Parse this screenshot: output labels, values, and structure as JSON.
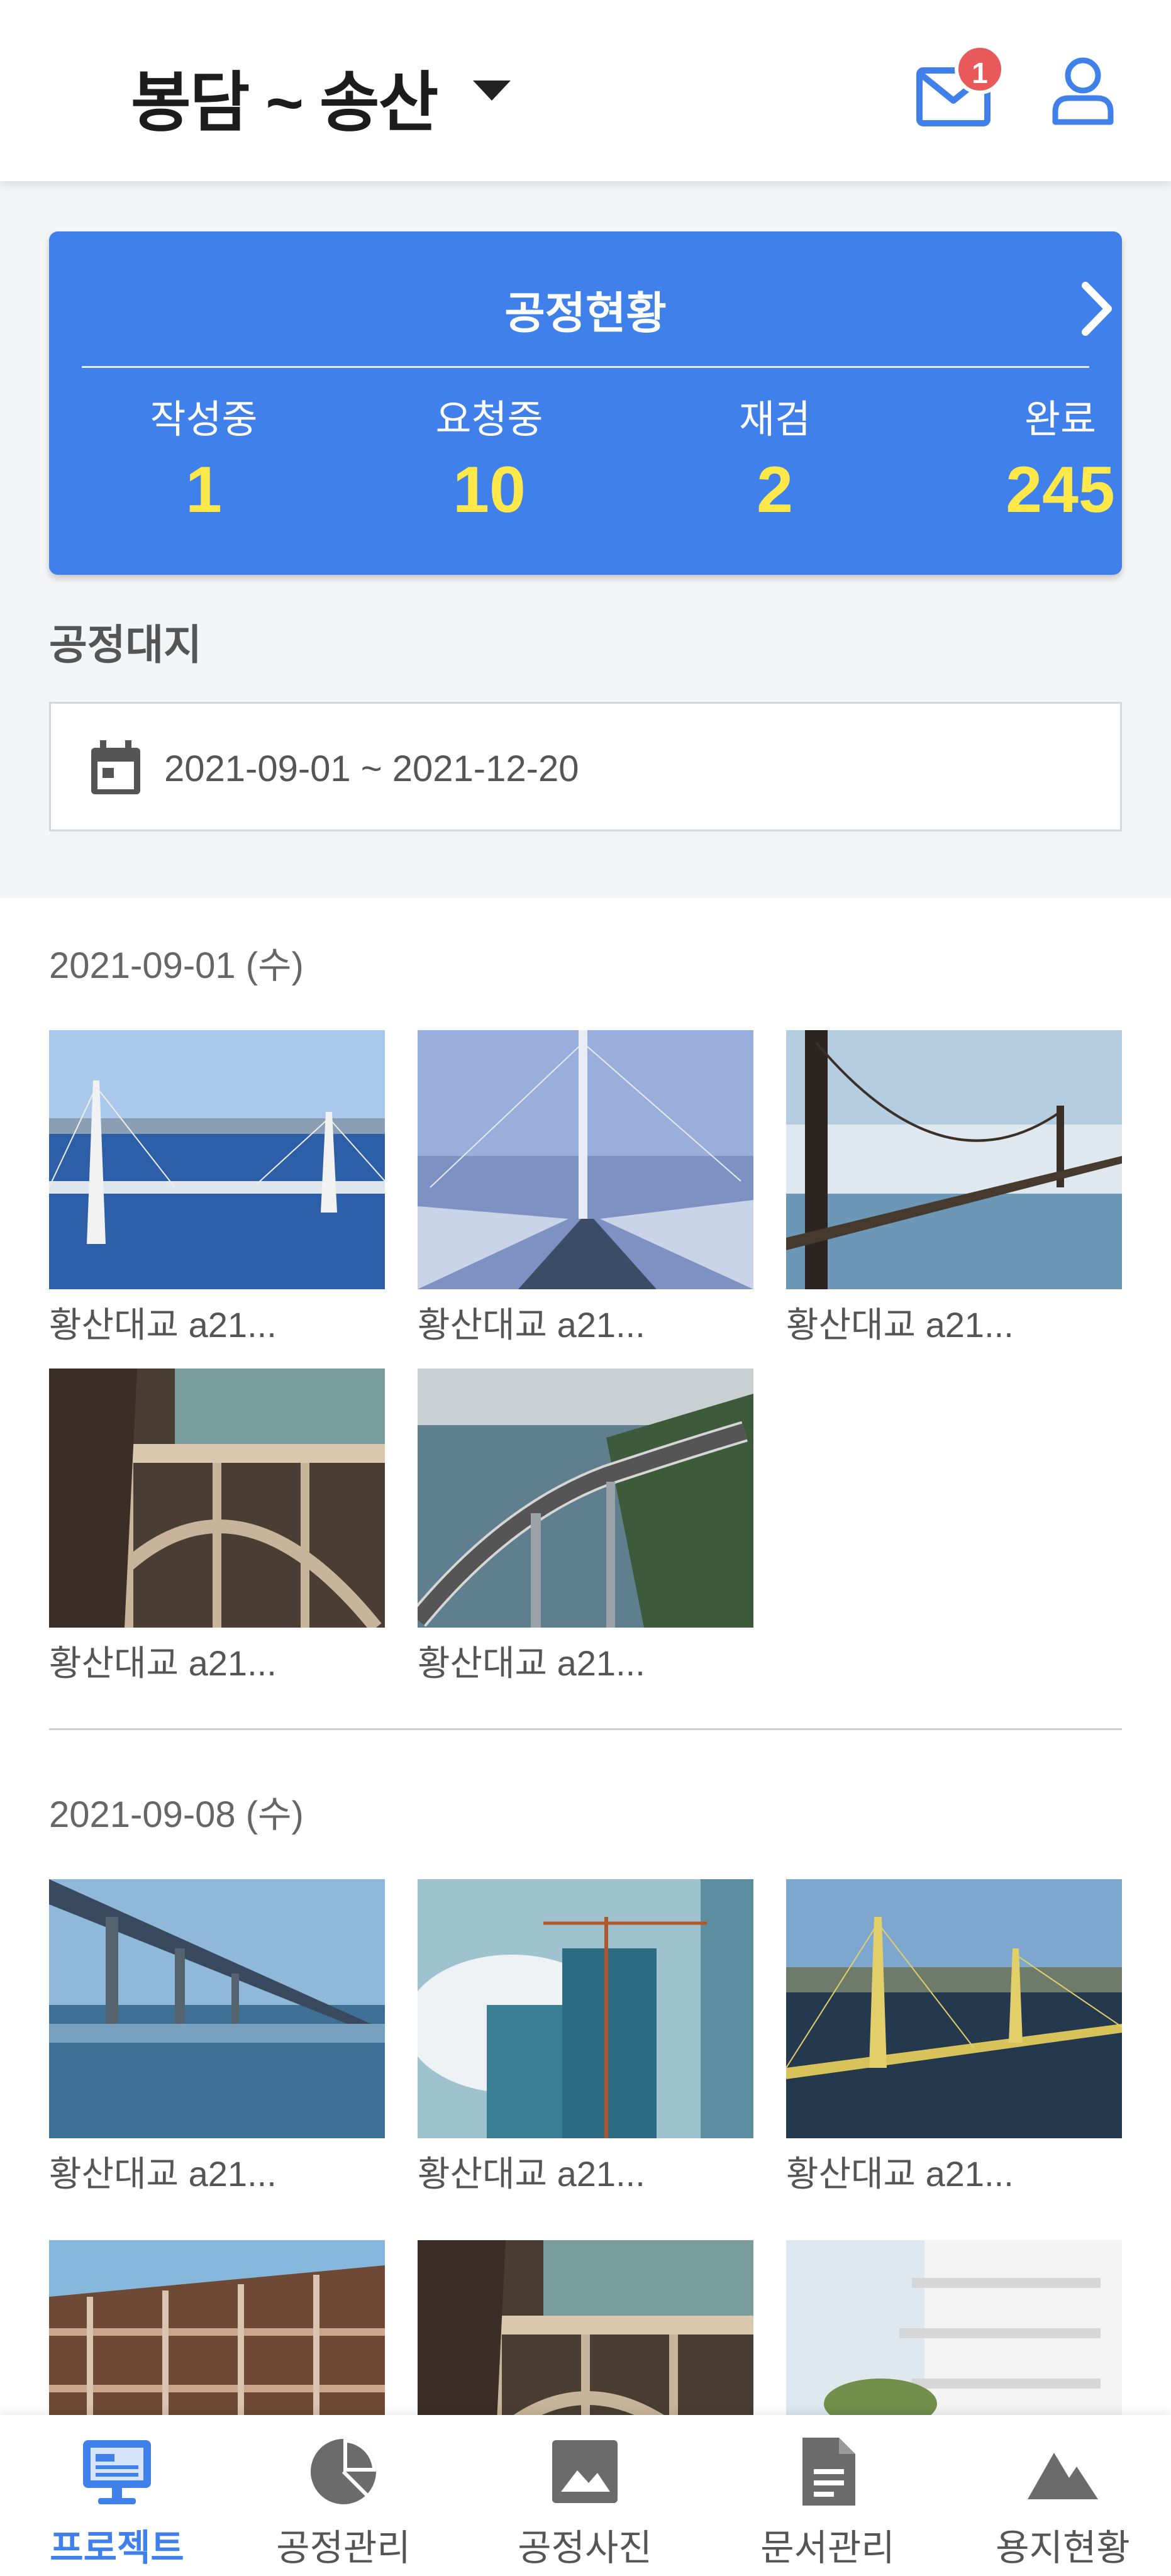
{
  "header": {
    "site_title": "봉담 ~ 송산",
    "mail_badge_count": "1",
    "icons": [
      "chevron-down-icon",
      "mail-icon",
      "user-icon"
    ]
  },
  "status_card": {
    "title": "공정현황",
    "stats": [
      {
        "label": "작성중",
        "value": "1"
      },
      {
        "label": "요청중",
        "value": "10"
      },
      {
        "label": "재검",
        "value": "2"
      },
      {
        "label": "완료",
        "value": "245"
      }
    ],
    "colors": {
      "card": "#3f80ea",
      "value": "#ffe84a"
    }
  },
  "filter": {
    "section_label": "공정대지",
    "date_range": "2021-09-01 ~ 2021-12-20"
  },
  "groups": [
    {
      "date": "2021-09-01 (수)",
      "photos": [
        {
          "caption": "황산대교 a21..."
        },
        {
          "caption": "황산대교 a21..."
        },
        {
          "caption": "황산대교 a21..."
        },
        {
          "caption": "황산대교 a21..."
        },
        {
          "caption": "황산대교 a21..."
        }
      ]
    },
    {
      "date": "2021-09-08 (수)",
      "photos": [
        {
          "caption": "황산대교 a21..."
        },
        {
          "caption": "황산대교 a21..."
        },
        {
          "caption": "황산대교 a21..."
        },
        {
          "caption": ""
        },
        {
          "caption": ""
        },
        {
          "caption": ""
        }
      ]
    }
  ],
  "bottom_nav": [
    {
      "label": "프로젝트",
      "icon": "monitor-icon",
      "active": true
    },
    {
      "label": "공정관리",
      "icon": "pie-chart-icon",
      "active": false
    },
    {
      "label": "공정사진",
      "icon": "image-icon",
      "active": false
    },
    {
      "label": "문서관리",
      "icon": "document-icon",
      "active": false
    },
    {
      "label": "용지현황",
      "icon": "mountain-icon",
      "active": false
    }
  ]
}
